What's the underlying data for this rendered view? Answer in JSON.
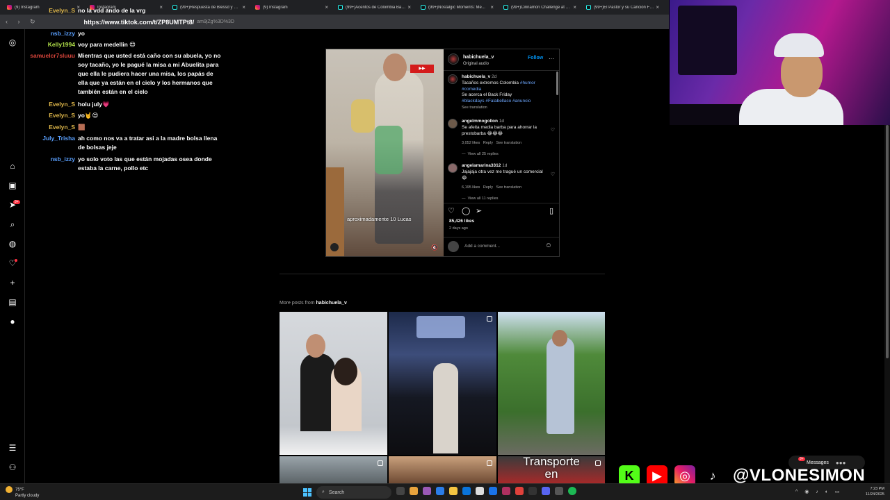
{
  "browser": {
    "tabs": [
      {
        "label": "(9) Instagram",
        "icon": "instagram-icon"
      },
      {
        "label": "Instagram",
        "icon": "instagram-icon"
      },
      {
        "label": "(99+)Respuesta de Blessd y W...",
        "icon": "tiktok-icon"
      },
      {
        "label": "(9) Instagram",
        "icon": "instagram-icon"
      },
      {
        "label": "(99+)Acentos de Colombia Bar...",
        "icon": "tiktok-icon"
      },
      {
        "label": "(99+)Nostalgic Moments: Me...",
        "icon": "tiktok-icon"
      },
      {
        "label": "(99+)Cinnamon Challenge at S...",
        "icon": "tiktok-icon"
      },
      {
        "label": "(99+)El Pastor y su Canción Fa...",
        "icon": "tiktok-icon"
      }
    ],
    "url_main": "https://www.tiktok.com/t/ZP8UMTPt8/",
    "url_rest": "am9jZg%3D%3D"
  },
  "chat": {
    "messages": [
      {
        "user": "Evelyn_S",
        "color": "#e0b84a",
        "text": "no la vdd ando de la vrg"
      },
      {
        "user": "nsb_izzy",
        "color": "#5aa0ff",
        "text": "yo"
      },
      {
        "user": "Kelly1994",
        "color": "#b3e24a",
        "text": "voy para medellin 😍"
      },
      {
        "user": "samuelcr7sluuu",
        "color": "#d9453b",
        "text": "Mientras que usted está caño con su abuela, yo no soy tacaño, yo le pagué la misa a mi Abuelita para que ella le pudiera hacer una misa, los papás de ella que ya están en el cielo y los hermanos que también están en el cielo"
      },
      {
        "user": "Evelyn_S",
        "color": "#e0b84a",
        "text": "holu july💗"
      },
      {
        "user": "Evelyn_S",
        "color": "#e0b84a",
        "text": "yo🤘😍"
      },
      {
        "user": "Evelyn_S",
        "color": "#e0b84a",
        "text": "🟫"
      },
      {
        "user": "July_Trisha",
        "color": "#5aa0ff",
        "text": "ah como nos va a tratar asi a la madre bolsa llena de bolsas jeje"
      },
      {
        "user": "nsb_izzy",
        "color": "#5aa0ff",
        "text": "yo solo voto las que están mojadas osea donde estaba la carne, pollo etc"
      }
    ]
  },
  "post": {
    "username": "habichuela_v",
    "audio": "Original audio",
    "follow_label": "Follow",
    "caption_user": "habichuela_v",
    "caption_time": "2d",
    "caption_line1": "Tacaños extremos Colombia",
    "caption_tags1": "#humor",
    "caption_tags2": "#comedia",
    "caption_line2": "Se acerca el Back Friday",
    "caption_tags3": "#blackdays #Falabellaco #anuncio",
    "see_translation": "See translation",
    "video_caption": "aproximadamente 10 Lucas",
    "comments": [
      {
        "user": "angelmmogollon",
        "time": "1d",
        "text": "Se afeita media barba para ahorrar la prestobarba 😂😂😂",
        "likes": "3,052 likes",
        "reply": "Reply",
        "translate": "See translation",
        "replies": "View all 25 replies"
      },
      {
        "user": "angelamarina3312",
        "time": "1d",
        "text": "Jajajaja otra vez me tragué un comercial 😂",
        "likes": "6,195 likes",
        "reply": "Reply",
        "translate": "See translation",
        "replies": "View all 11 replies"
      }
    ],
    "likes": "85,426 likes",
    "ago": "2 days ago",
    "add_comment_placeholder": "Add a comment..."
  },
  "more_posts": {
    "prefix": "More posts from",
    "user": "habichuela_v"
  },
  "grid_captions": {
    "tile6_line1": "Transporte",
    "tile6_line2": "en"
  },
  "social": {
    "handle": "@VLONESIMON"
  },
  "messages_pill": {
    "label": "Messages",
    "badge": "9+"
  },
  "taskbar": {
    "temp": "75°F",
    "weather": "Partly cloudy",
    "search": "Search",
    "time": "7:23 PM",
    "date": "11/24/2025"
  },
  "rail_badge": "9+",
  "colors": {
    "ig_blue": "#0095f6",
    "ig_red": "#ff3040",
    "taskbar": "#1c1c1c"
  }
}
